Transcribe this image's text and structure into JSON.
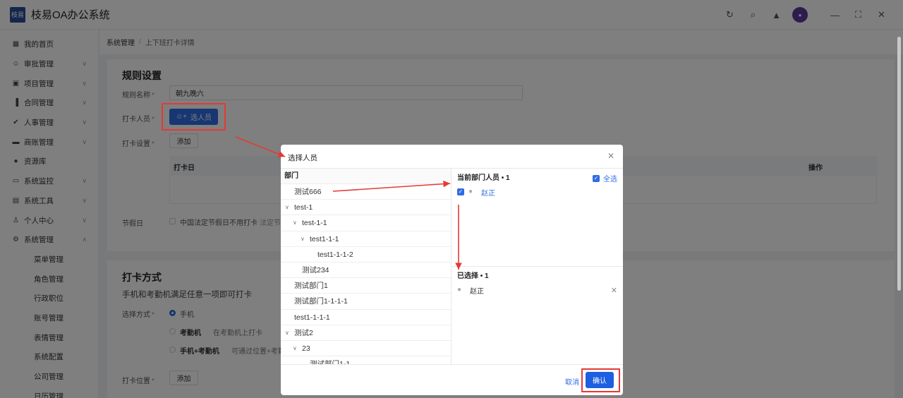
{
  "app": {
    "title": "枝易OA办公系统",
    "logo_text": "枝易"
  },
  "header_icons": [
    "refresh-icon",
    "search-icon",
    "bell-icon",
    "avatar",
    "minimize-icon",
    "maximize-icon",
    "close-icon"
  ],
  "sidebar": {
    "items": [
      {
        "label": "我的首页",
        "icon": "grid-icon",
        "expandable": false
      },
      {
        "label": "审批管理",
        "icon": "user-icon",
        "expandable": true
      },
      {
        "label": "项目管理",
        "icon": "folder-icon",
        "expandable": true
      },
      {
        "label": "合同管理",
        "icon": "chart-icon",
        "expandable": true
      },
      {
        "label": "人事管理",
        "icon": "check-circle-icon",
        "expandable": true
      },
      {
        "label": "商账管理",
        "icon": "car-icon",
        "expandable": true
      },
      {
        "label": "资源库",
        "icon": "pin-icon",
        "expandable": false
      },
      {
        "label": "系统监控",
        "icon": "monitor-icon",
        "expandable": true
      },
      {
        "label": "系统工具",
        "icon": "toolbox-icon",
        "expandable": true
      },
      {
        "label": "个人中心",
        "icon": "person-icon",
        "expandable": true
      },
      {
        "label": "系统管理",
        "icon": "gear-icon",
        "expandable": true,
        "expanded": true
      }
    ],
    "sub_items": [
      "菜单管理",
      "角色管理",
      "行政职位",
      "账号管理",
      "表情管理",
      "系统配置",
      "公司管理",
      "日历管理"
    ]
  },
  "breadcrumb": {
    "parent": "系统管理",
    "separator": "/",
    "current": "上下班打卡详情"
  },
  "rules": {
    "title": "规则设置",
    "name_label": "规则名称",
    "name_value": "朝九晚六",
    "people_label": "打卡人员",
    "select_people_button": "选人员",
    "checkin_settings_label": "打卡设置",
    "add_button": "添加",
    "table_col_checkin_day": "打卡日",
    "table_col_ops": "操作",
    "holiday_label": "节假日",
    "holiday_option": "中国法定节假日不用打卡",
    "holiday_hint": "法定节"
  },
  "checkin_method": {
    "title": "打卡方式",
    "desc": "手机和考勤机满足任意一项即可打卡",
    "select_label": "选择方式",
    "opt_phone": "手机",
    "opt_machine": "考勤机",
    "opt_machine_hint": "在考勤机上打卡",
    "opt_both": "手机+考勤机",
    "opt_both_hint": "可通过位置+考勤机",
    "location_label": "打卡位置",
    "add_button": "添加"
  },
  "modal": {
    "title": "选择人员",
    "dept_header": "部门",
    "tree": [
      {
        "label": "测试666",
        "level": 0,
        "toggle": false
      },
      {
        "label": "test-1",
        "level": 0,
        "toggle": true
      },
      {
        "label": "test-1-1",
        "level": 1,
        "toggle": true
      },
      {
        "label": "test1-1-1",
        "level": 2,
        "toggle": true
      },
      {
        "label": "test1-1-1-2",
        "level": 3,
        "toggle": false
      },
      {
        "label": "测试234",
        "level": 1,
        "toggle": false
      },
      {
        "label": "测试部门1",
        "level": 0,
        "toggle": false
      },
      {
        "label": "测试部门1-1-1-1",
        "level": 0,
        "toggle": false
      },
      {
        "label": "test1-1-1-1",
        "level": 0,
        "toggle": false
      },
      {
        "label": "测试2",
        "level": 0,
        "toggle": true
      },
      {
        "label": "23",
        "level": 1,
        "toggle": true
      },
      {
        "label": "测试部门1-1",
        "level": 2,
        "toggle": false
      }
    ],
    "current_dept_header": "当前部门人员 • 1",
    "select_all": "全选",
    "current_people": [
      "赵正"
    ],
    "selected_header": "已选择 • 1",
    "selected_people": [
      "赵正"
    ],
    "cancel": "取消",
    "confirm": "确认"
  },
  "colors": {
    "primary": "#2f6ce5",
    "annotation_red": "#e53935",
    "required": "#f56c6c"
  }
}
